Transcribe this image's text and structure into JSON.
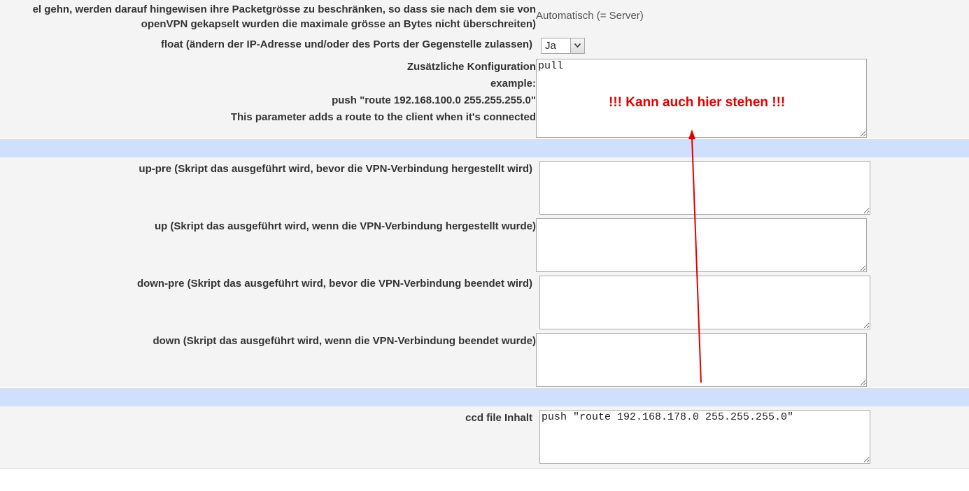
{
  "mtu": {
    "label_line1": "el gehn, werden darauf hingewisen ihre Packetgrösse zu beschränken, so dass sie nach dem sie von",
    "label_line2": "openVPN gekapselt wurden die maximale grösse an Bytes nicht überschreiten)",
    "value": "Automatisch (= Server)"
  },
  "float": {
    "label": "float (ändern der IP-Adresse und/oder des Ports der Gegenstelle zulassen)",
    "selected": "Ja"
  },
  "extra_config": {
    "label_line1": "Zusätzliche Konfiguration",
    "label_line2": "example:",
    "label_line3": "push \"route 192.168.100.0 255.255.255.0\"",
    "label_line4": "This parameter adds a route to the client when it's connected",
    "value": "pull"
  },
  "annotation": {
    "text": "!!! Kann auch hier stehen !!!",
    "color": "#e10000"
  },
  "scripts": {
    "up_pre_label": "up-pre (Skript das ausgeführt wird, bevor die VPN-Verbindung hergestellt wird)",
    "up_label": "up (Skript das ausgeführt wird, wenn die VPN-Verbindung hergestellt wurde)",
    "down_pre_label": "down-pre (Skript das ausgeführt wird, bevor die VPN-Verbindung beendet wird)",
    "down_label": "down (Skript das ausgeführt wird, wenn die VPN-Verbindung beendet wurde)"
  },
  "ccd": {
    "label": "ccd file Inhalt",
    "value": "push \"route 192.168.178.0 255.255.255.0\""
  },
  "colors": {
    "panel_bg": "#f4f4f4",
    "separator_bg": "#cfdffc",
    "label_text": "#333333"
  }
}
